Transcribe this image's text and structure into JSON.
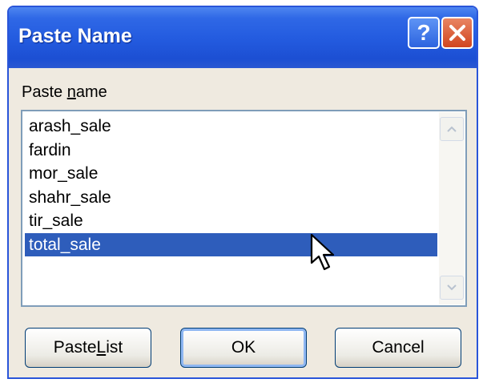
{
  "dialog": {
    "title": "Paste Name",
    "help_glyph": "?",
    "close_glyph": "×"
  },
  "list_label": {
    "prefix": "Paste ",
    "mnemonic": "n",
    "suffix": "ame"
  },
  "names": {
    "items": [
      "arash_sale",
      "fardin",
      "mor_sale",
      "shahr_sale",
      "tir_sale",
      "total_sale"
    ],
    "selected": "total_sale"
  },
  "buttons": {
    "paste_list": {
      "prefix": "Paste ",
      "mnemonic": "L",
      "suffix": "ist"
    },
    "ok": "OK",
    "cancel": "Cancel"
  },
  "icons": [
    "help-icon",
    "close-icon",
    "scroll-up-icon",
    "scroll-down-icon",
    "mouse-pointer-icon"
  ],
  "colors": {
    "titlebar": "#245ce0",
    "selection": "#2e5dbb",
    "dialog_background": "#efeae0",
    "close_button": "#d1451f"
  }
}
